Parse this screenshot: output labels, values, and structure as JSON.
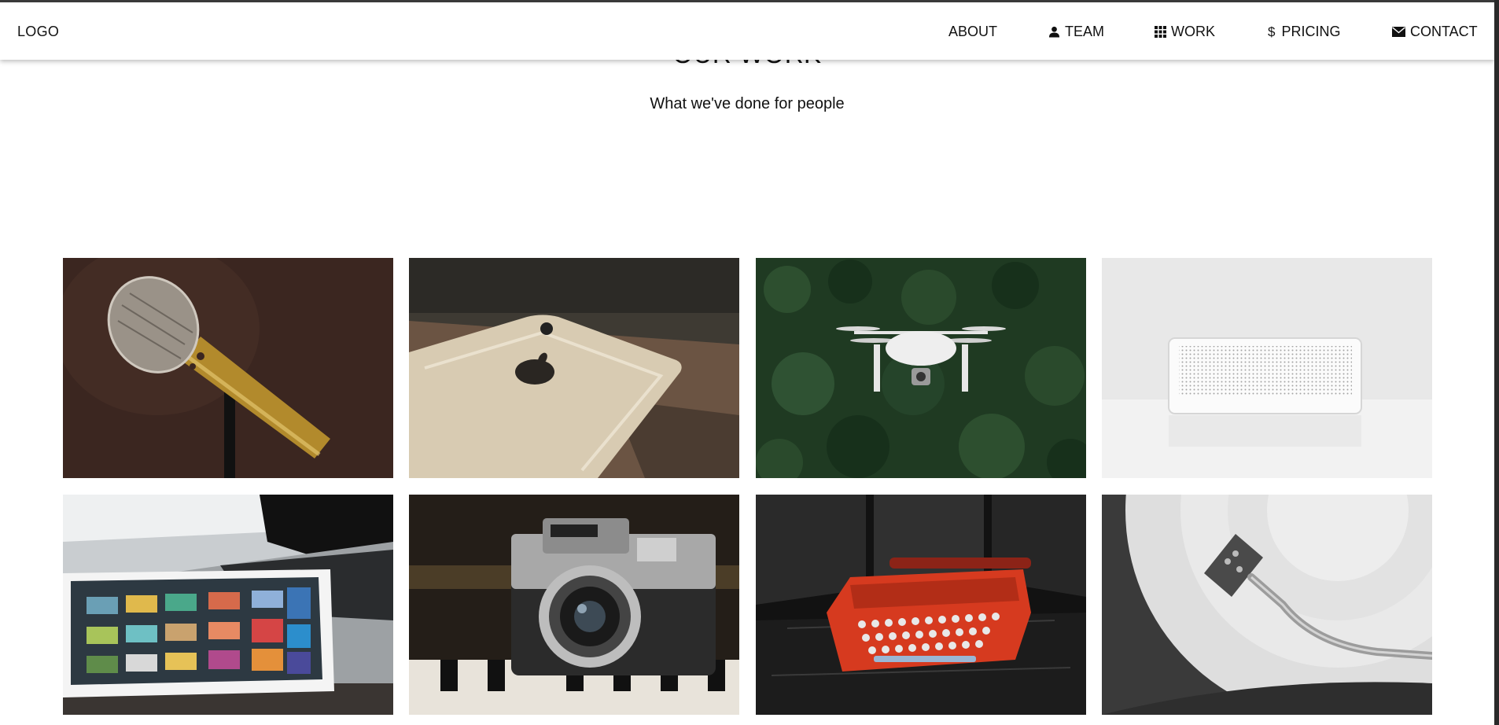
{
  "navbar": {
    "logo": "LOGO",
    "items": [
      {
        "label": "ABOUT",
        "icon": ""
      },
      {
        "label": "TEAM",
        "icon": "user-icon"
      },
      {
        "label": "WORK",
        "icon": "grid-icon"
      },
      {
        "label": "PRICING",
        "icon": "dollar-icon"
      },
      {
        "label": "CONTACT",
        "icon": "envelope-icon"
      }
    ],
    "pricing_symbol": "$"
  },
  "work": {
    "title": "OUR WORK",
    "subtitle": "What we've done for people",
    "items": [
      {
        "subject": "microphone"
      },
      {
        "subject": "phone"
      },
      {
        "subject": "drone"
      },
      {
        "subject": "speaker"
      },
      {
        "subject": "tablet-laptop"
      },
      {
        "subject": "camera"
      },
      {
        "subject": "typewriter"
      },
      {
        "subject": "turntable"
      }
    ]
  }
}
